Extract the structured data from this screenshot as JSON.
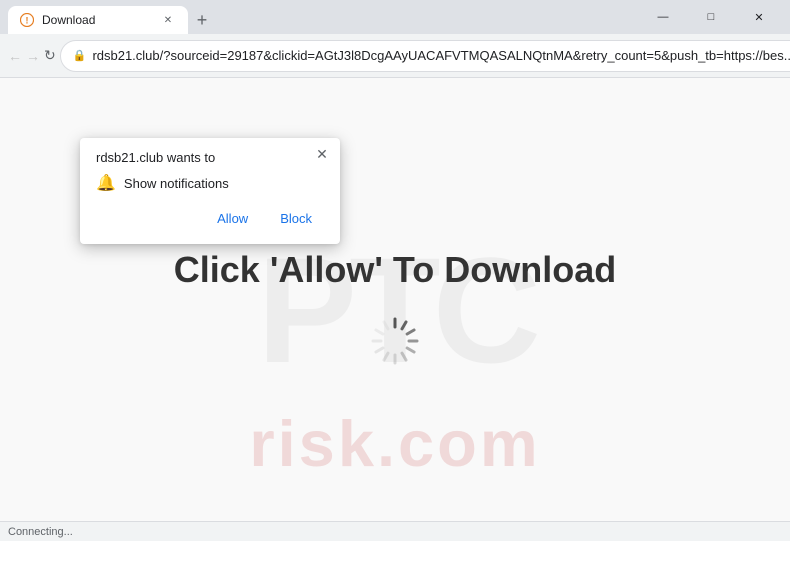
{
  "window": {
    "title": "Download",
    "favicon": "🔄"
  },
  "tabs": [
    {
      "label": "Download",
      "favicon": "warning",
      "active": true
    }
  ],
  "new_tab_label": "+",
  "window_controls": {
    "minimize": "—",
    "maximize": "□",
    "close": "✕"
  },
  "address_bar": {
    "url": "rdsb21.club/?sourceid=29187&clickid=AGtJ3l8DcgAAyUACAFVTMQASALNQtnMA&retry_count=5&push_tb=https://bes...",
    "lock_icon": "🔒",
    "star_icon": "☆",
    "menu_icon": "⋮"
  },
  "notification_popup": {
    "title": "rdsb21.club wants to",
    "show_notifications_label": "Show notifications",
    "allow_label": "Allow",
    "block_label": "Block",
    "close_icon": "✕",
    "bell_icon": "🔔"
  },
  "page": {
    "headline": "Click 'Allow' To Download"
  },
  "watermark": {
    "top_text": "PTC",
    "bottom_text": "risk.com"
  },
  "status_bar": {
    "text": "Connecting..."
  },
  "colors": {
    "accent_blue": "#1a73e8",
    "tab_bg": "#ffffff",
    "chrome_bg": "#dee1e6"
  }
}
